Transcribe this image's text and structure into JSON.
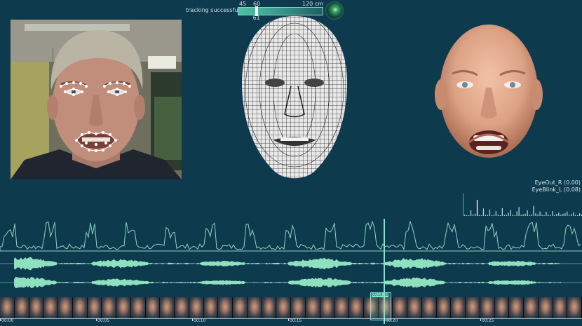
{
  "tracking": {
    "label": "tracking successful",
    "scale_min": "45",
    "scale_mark": "60",
    "scale_max": "120 cm",
    "distance_value": "61",
    "distance_cm": 61,
    "range_cm": [
      45,
      120
    ]
  },
  "blendshapes": {
    "labels": [
      "EyeOut_R (0.00)",
      "EyeBlink_L (0.08)"
    ],
    "bar_values": [
      0.05,
      0.02,
      0.03,
      0.25,
      0.06,
      0.1,
      0.72,
      0.04,
      0.03,
      0.33,
      0.05,
      0.04,
      0.28,
      0.02,
      0.06,
      0.22,
      0.05,
      0.03,
      0.35,
      0.04,
      0.06,
      0.14,
      0.26,
      0.05,
      0.03,
      0.2,
      0.4,
      0.05,
      0.07,
      0.1,
      0.25,
      0.04,
      0.08,
      0.45,
      0.12,
      0.06,
      0.2,
      0.05,
      0.03,
      0.18,
      0.06,
      0.04,
      0.22,
      0.05,
      0.09,
      0.15,
      0.05,
      0.1,
      0.12,
      0.2,
      0.05,
      0.09,
      0.16,
      0.05,
      0.03,
      0.12,
      0.06
    ]
  },
  "timeline": {
    "ticks": [
      "00:00",
      "00:05",
      "00:10",
      "00:15",
      "00:20",
      "00:25"
    ],
    "current_frame_label": "00:19:00",
    "thumbnail_count": 40
  },
  "colors": {
    "background": "#0e3a4e",
    "accent": "#7de6c8",
    "waveform": "#8ee0bf"
  },
  "icons": {
    "status": "status-light-icon"
  }
}
